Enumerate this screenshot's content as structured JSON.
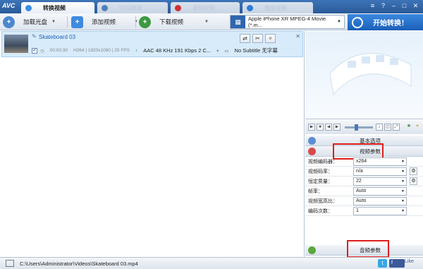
{
  "app": {
    "logo": "AVC"
  },
  "tabs": [
    {
      "label": "转换视频",
      "active": true
    },
    {
      "label": "DVD刻录",
      "active": false
    },
    {
      "label": "录制视频",
      "active": false
    },
    {
      "label": "播放视频",
      "active": false
    }
  ],
  "window_buttons": {
    "menu": "≡",
    "help": "?",
    "minimize": "–",
    "maximize": "□",
    "close": "✕"
  },
  "toolbar": {
    "add_disc": "加载光盘",
    "add_video": "添加视频",
    "download_video": "下载视频",
    "profile": "Apple iPhone XR MPEG-4 Movie (*.m...",
    "convert": "开始转换！"
  },
  "file": {
    "name": "Skateboard 03",
    "duration": "00:00:30",
    "codec": "H264 | 1920x1080 | 25 FPS",
    "audio": "AAC 48 KHz 191 Kbps 2 C...",
    "subtitle": "No Subtitle 无字幕",
    "checked": true
  },
  "sections": {
    "basic": "基本选项",
    "video": "视频参数",
    "audio": "音频参数"
  },
  "video_params": [
    {
      "label": "视频编码器：",
      "value": "x264",
      "gear": false
    },
    {
      "label": "视频码率：",
      "value": "n/a",
      "gear": true
    },
    {
      "label": "恒定质量：",
      "value": "22",
      "gear": true
    },
    {
      "label": "帧率：",
      "value": "Auto",
      "gear": false
    },
    {
      "label": "视频宽高比：",
      "value": "Auto",
      "gear": false
    },
    {
      "label": "编码次数：",
      "value": "1",
      "gear": false
    }
  ],
  "status": {
    "path": "C:\\Users\\Administrator\\Videos\\Skateboard 03.mp4",
    "like": "Like",
    "fb": "f"
  },
  "colors": {
    "accent": "#2a5a98",
    "highlight_box": "#e01d1d",
    "selected_row": "#d7ebfb"
  }
}
